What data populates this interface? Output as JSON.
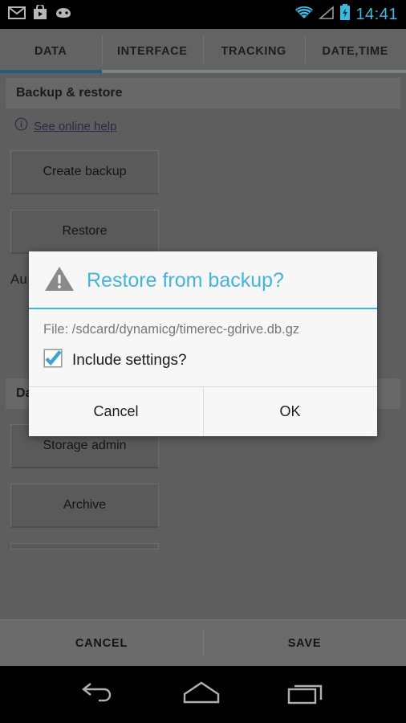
{
  "status_bar": {
    "icons": [
      "email-icon",
      "play-store-icon",
      "android-face-icon"
    ],
    "wifi_icon": "wifi-icon",
    "signal_icon": "signal-no-service-icon",
    "battery_icon": "battery-charging-icon",
    "time": "14:41",
    "accent_color": "#3fb8e0"
  },
  "tabs": [
    {
      "label": "DATA",
      "active": true
    },
    {
      "label": "INTERFACE",
      "active": false
    },
    {
      "label": "TRACKING",
      "active": false
    },
    {
      "label": "DATE,TIME",
      "active": false
    }
  ],
  "active_tab_underline_color": "#1f5f75",
  "content": {
    "backup_section": {
      "header": "Backup & restore",
      "help_icon": "info-circle-icon",
      "help_link": "See online help",
      "buttons": [
        "Create backup",
        "Restore"
      ],
      "partial_text": "Au"
    },
    "data_admin_section": {
      "header": "Data administration",
      "buttons": [
        "Storage admin",
        "Archive"
      ]
    }
  },
  "action_bar": {
    "cancel_label": "CANCEL",
    "save_label": "SAVE"
  },
  "nav_bar": {
    "back_icon": "back-arrow-icon",
    "home_icon": "home-icon",
    "recents_icon": "recent-apps-icon"
  },
  "dialog": {
    "warning_icon": "warning-triangle-icon",
    "title": "Restore from backup?",
    "title_color": "#44b4dd",
    "divider_color": "#33b5e5",
    "file_text": "File: /sdcard/dynamicg/timerec-gdrive.db.gz",
    "checkbox": {
      "icon": "checkbox-checked-icon",
      "checked": true,
      "label": "Include settings?"
    },
    "cancel_label": "Cancel",
    "ok_label": "OK"
  }
}
